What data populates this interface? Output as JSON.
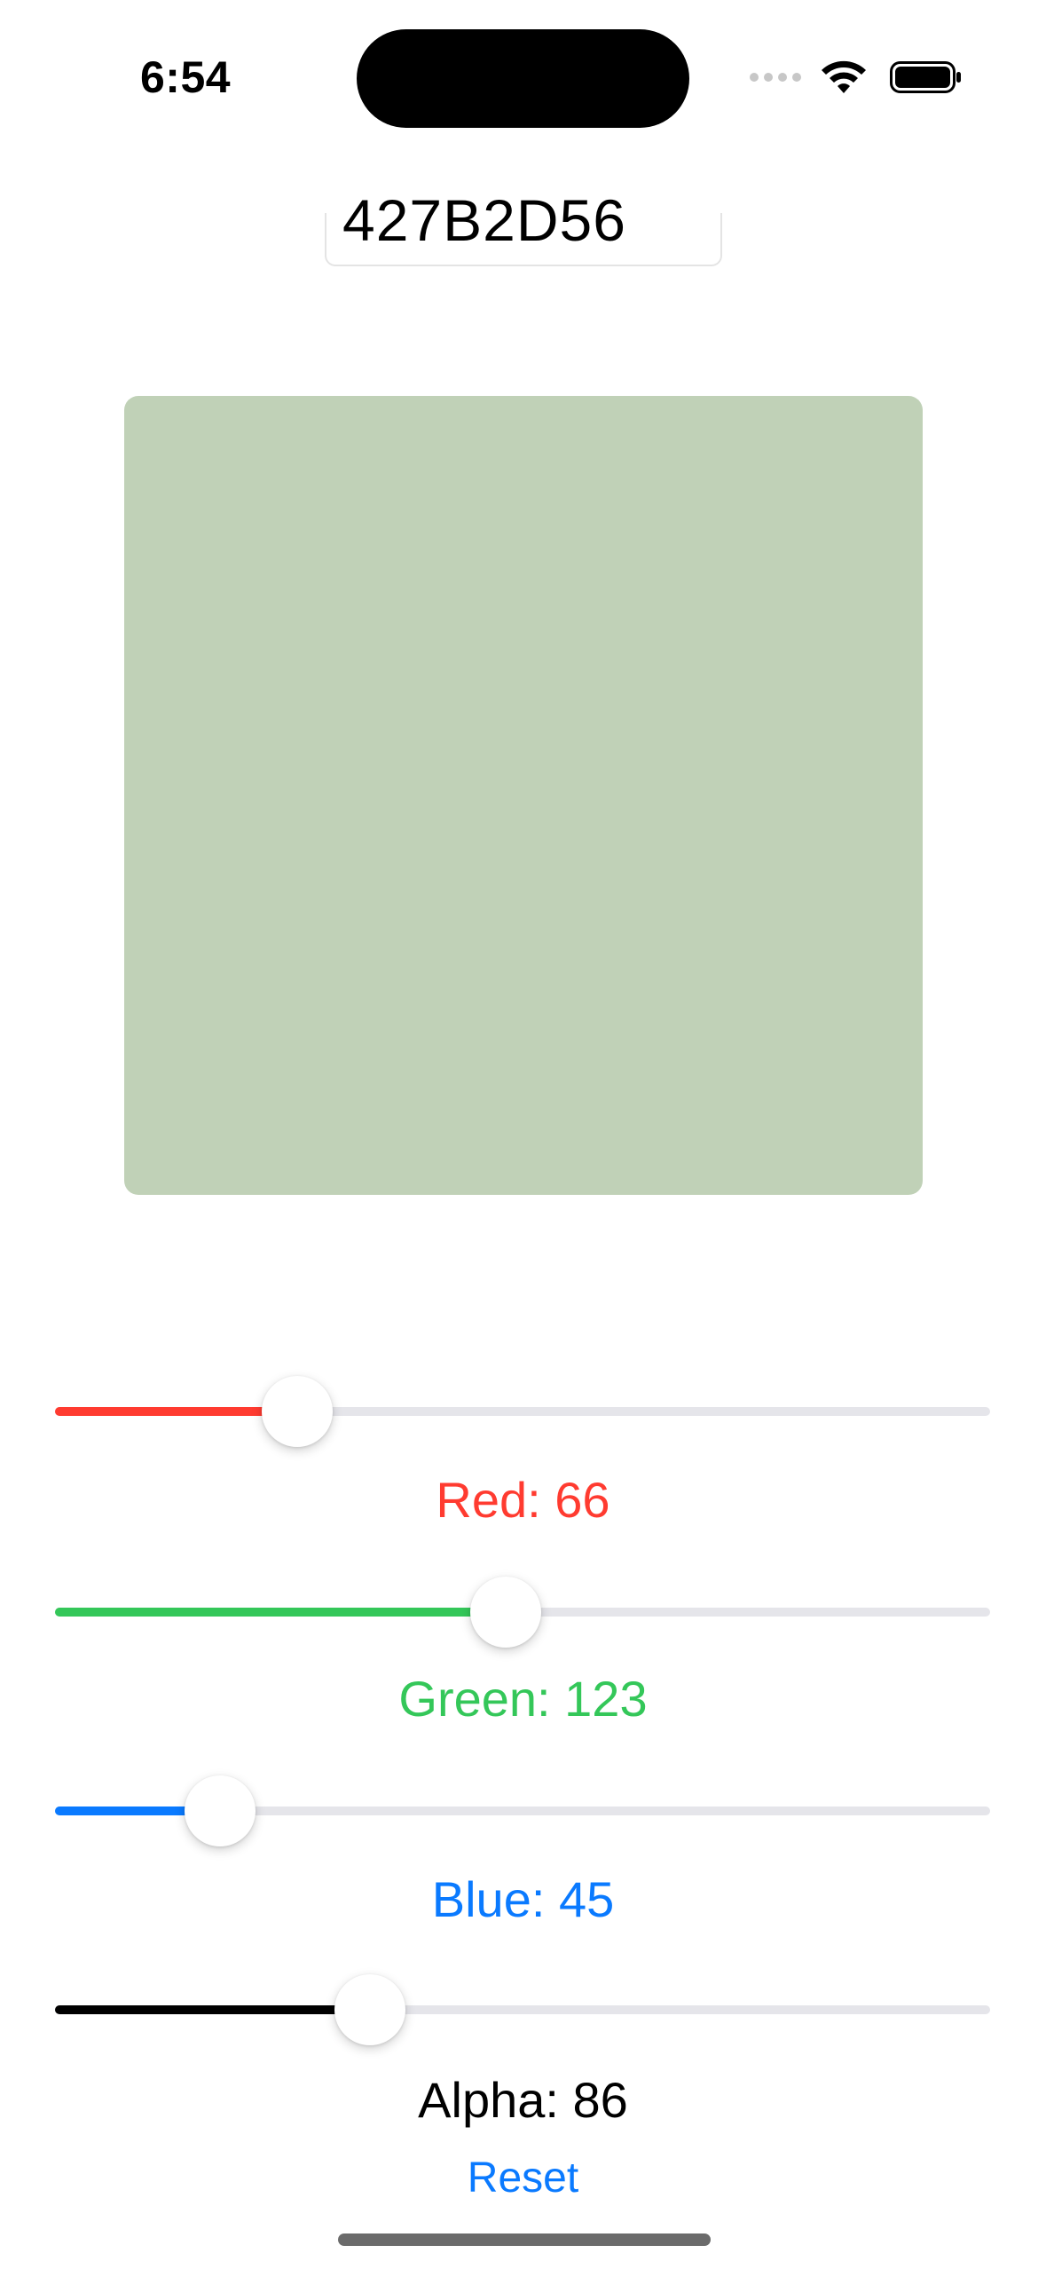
{
  "status_bar": {
    "time": "6:54"
  },
  "hex_input": {
    "value": "427B2D56"
  },
  "preview": {
    "color": "#c0d1b7"
  },
  "sliders": [
    {
      "key": "red",
      "label": "Red: 66",
      "value": 66,
      "max": 255,
      "color": "#ff3b30"
    },
    {
      "key": "green",
      "label": "Green: 123",
      "value": 123,
      "max": 255,
      "color": "#34c759"
    },
    {
      "key": "blue",
      "label": "Blue: 45",
      "value": 45,
      "max": 255,
      "color": "#0a7aff"
    },
    {
      "key": "alpha",
      "label": "Alpha: 86",
      "value": 86,
      "max": 255,
      "color": "#000000"
    }
  ],
  "reset_label": "Reset"
}
